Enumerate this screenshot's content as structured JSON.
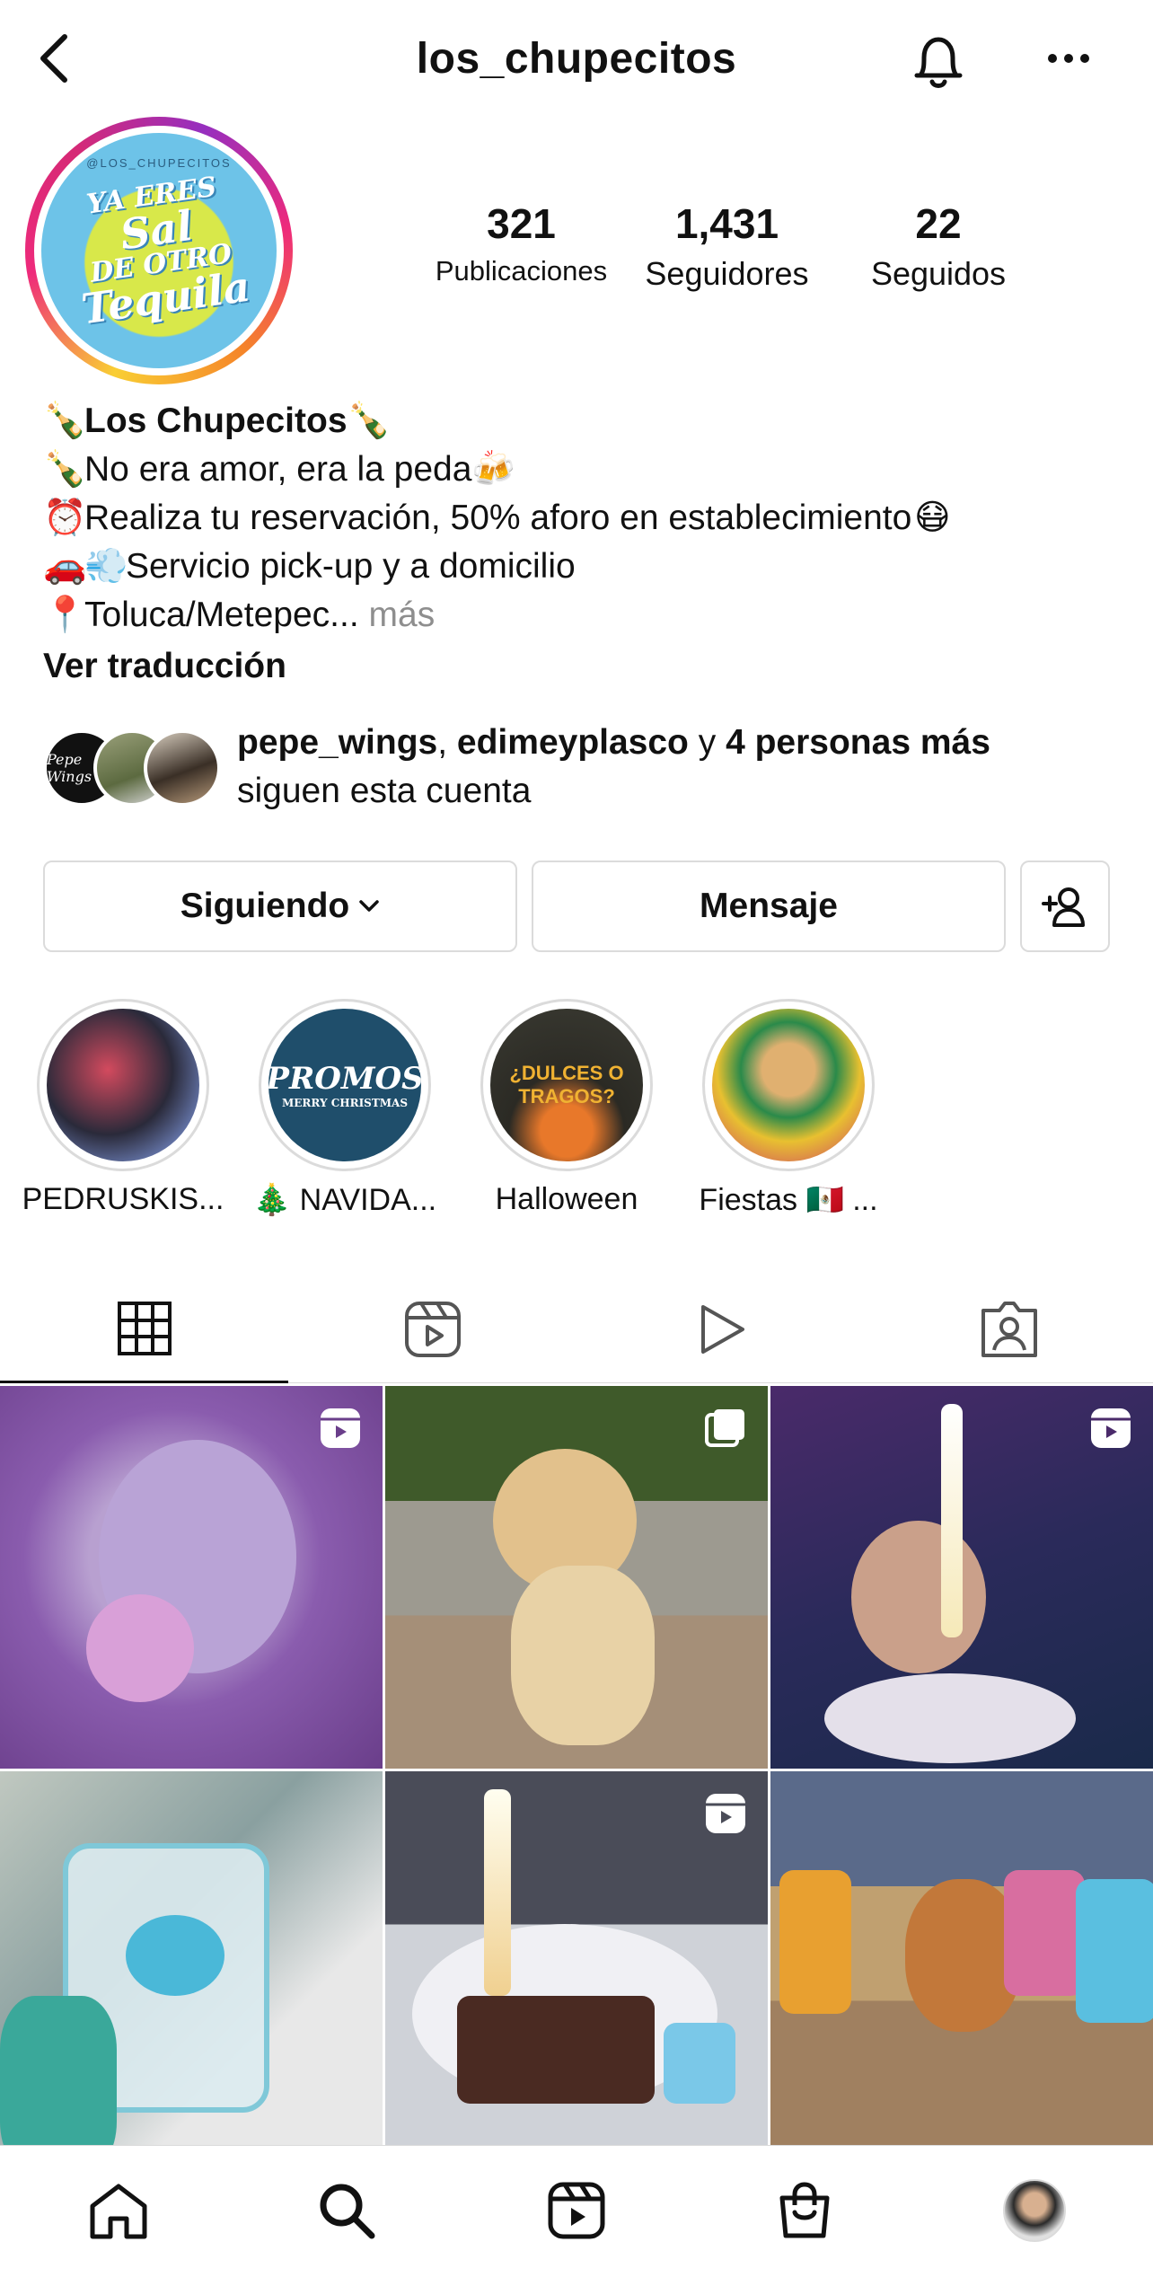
{
  "header": {
    "title": "los_chupecitos",
    "back_icon": "chevron-left-icon",
    "bell_icon": "bell-icon",
    "more_icon": "ellipsis-icon"
  },
  "avatar": {
    "small_text": "@LOS_CHUPECITOS",
    "line1": "YA ERES",
    "line2": "Sal",
    "line3": "DE OTRO",
    "line4": "Tequila"
  },
  "stats": [
    {
      "value": "321",
      "label": "Publicaciones"
    },
    {
      "value": "1,431",
      "label": "Seguidores"
    },
    {
      "value": "22",
      "label": "Seguidos"
    }
  ],
  "bio": {
    "name": "Los Chupecitos",
    "line2": "No era amor, era la peda",
    "line3": "Realiza tu reservación, 50% aforo en establecimiento",
    "line4": "Servicio pick-up y a domicilio",
    "line5": "Toluca/Metepec...",
    "more": "más",
    "translate": "Ver traducción",
    "emoji_bottle": "🍾",
    "emoji_beer": "🍻",
    "emoji_clock": "⏰",
    "emoji_mask": "😷",
    "emoji_car": "🚗",
    "emoji_dash": "💨",
    "emoji_pin": "📍"
  },
  "followed_by": {
    "user1": "pepe_wings",
    "comma": ",",
    "user2": "edimeyplasco",
    "conj": "y",
    "others": "4 personas más",
    "suffix": "siguen esta cuenta",
    "fav1_text": "Pepe Wings"
  },
  "actions": {
    "following": "Siguiendo",
    "message": "Mensaje"
  },
  "highlights": [
    {
      "label": "PEDRUSKIS..."
    },
    {
      "label": "🎄 NAVIDA...",
      "img_text": "PROMOS",
      "img_sub": "MERRY CHRISTMAS"
    },
    {
      "label": "Halloween",
      "img_text": "¿DULCES O TRAGOS?"
    },
    {
      "label": "Fiestas 🇲🇽 ..."
    }
  ],
  "tabs": [
    "grid-icon",
    "reels-icon",
    "play-icon",
    "tagged-icon"
  ],
  "bottom_nav": [
    "home-icon",
    "search-icon",
    "reels-icon",
    "shop-icon",
    "profile-avatar"
  ],
  "colors": {
    "border": "#dbdbdb",
    "muted": "#8e8e8e",
    "text": "#111111"
  }
}
